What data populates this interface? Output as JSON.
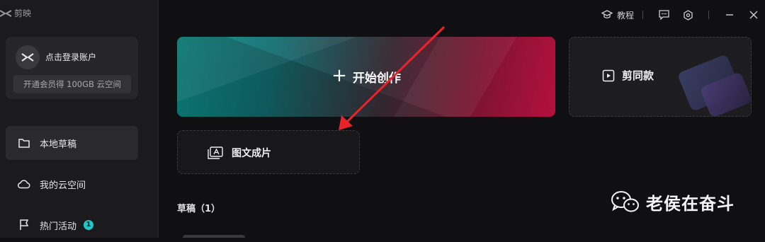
{
  "app": {
    "name": "剪映"
  },
  "sidebar": {
    "login_text": "点击登录账户",
    "vip_text": "开通会员得 100GB 云空间",
    "nav": [
      {
        "label": "本地草稿",
        "icon": "folder-icon",
        "active": true
      },
      {
        "label": "我的云空间",
        "icon": "cloud-icon"
      },
      {
        "label": "热门活动",
        "icon": "flag-icon",
        "badge": "1"
      }
    ]
  },
  "titlebar": {
    "tutorial_label": "教程",
    "icons": [
      "tutorial-icon",
      "feedback-icon",
      "settings-icon",
      "minimize-icon",
      "close-icon"
    ]
  },
  "main": {
    "start_creation_label": "开始创作",
    "template_label": "剪同款",
    "text_to_video_label": "图文成片",
    "drafts_title": "草稿（1）"
  },
  "watermark": {
    "text": "老侯在奋斗"
  },
  "colors": {
    "background": "#101012",
    "sidebar": "#1b1b1d",
    "accent_teal": "#0d8f8b",
    "accent_crimson": "#b5103d",
    "annotation_arrow": "#e8242a"
  }
}
